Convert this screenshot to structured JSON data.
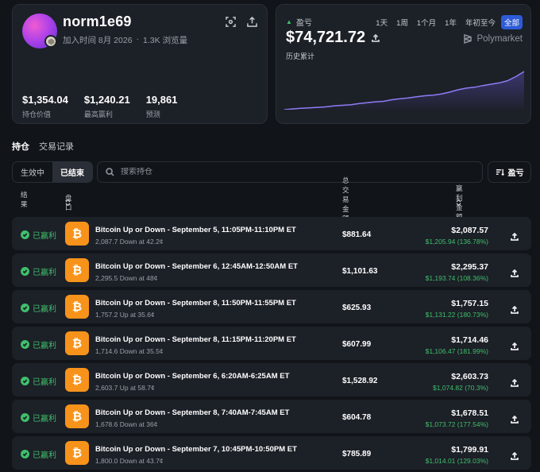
{
  "profile": {
    "username": "norm1e69",
    "joined": "加入时间 8月 2026",
    "separator": "·",
    "views": "1.3K 浏览量",
    "stats": [
      {
        "value": "$1,354.04",
        "label": "持仓价值"
      },
      {
        "value": "$1,240.21",
        "label": "最高赢利"
      },
      {
        "value": "19,861",
        "label": "预测"
      }
    ]
  },
  "pnl": {
    "label": "盈亏",
    "value": "$74,721.72",
    "sub": "历史累计",
    "brand": "Polymarket",
    "periods": [
      "1天",
      "1周",
      "1个月",
      "1年",
      "年初至今",
      "全部"
    ],
    "active_period": "全部",
    "colors": {
      "line": "#8e7cf5",
      "fill": "#4a3f8f"
    }
  },
  "chart_data": {
    "type": "area",
    "x": [
      0,
      1,
      2,
      3,
      4,
      5,
      6,
      7,
      8,
      9,
      10,
      11,
      12,
      13,
      14,
      15,
      16,
      17,
      18,
      19,
      20,
      21,
      22,
      23,
      24,
      25,
      26,
      27,
      28,
      29
    ],
    "values": [
      0,
      0.3,
      0.6,
      0.8,
      1.0,
      1.2,
      1.6,
      1.9,
      2.1,
      2.6,
      3.0,
      3.4,
      3.6,
      4.3,
      4.7,
      5.1,
      5.6,
      6.0,
      6.3,
      6.8,
      7.6,
      8.6,
      9.3,
      9.7,
      10.4,
      11.0,
      11.6,
      12.5,
      14.3,
      16.5
    ],
    "title": "",
    "xlabel": "",
    "ylabel": "",
    "grid": false
  },
  "tabs": [
    "持仓",
    "交易记录"
  ],
  "active_tab": "持仓",
  "segments": [
    "生效中",
    "已结束"
  ],
  "active_segment": "已结束",
  "search": {
    "placeholder": "搜索持仓"
  },
  "sort_label": "盈亏",
  "table": {
    "headers": {
      "result": "结果",
      "market": "盘口",
      "total": "总交易金额",
      "win": "赢利金额"
    },
    "rows": [
      {
        "status": "已赢利",
        "title": "Bitcoin Up or Down - September 5, 11:05PM-11:10PM ET",
        "sub": "2,087.7 Down at 42.2¢",
        "total": "$881.64",
        "win": "$2,087.57",
        "gain": "$1,205.94 (136.78%)"
      },
      {
        "status": "已赢利",
        "title": "Bitcoin Up or Down - September 6, 12:45AM-12:50AM ET",
        "sub": "2,295.5 Down at 48¢",
        "total": "$1,101.63",
        "win": "$2,295.37",
        "gain": "$1,193.74 (108.36%)"
      },
      {
        "status": "已赢利",
        "title": "Bitcoin Up or Down - September 8, 11:50PM-11:55PM ET",
        "sub": "1,757.2 Up at 35.6¢",
        "total": "$625.93",
        "win": "$1,757.15",
        "gain": "$1,131.22 (180.73%)"
      },
      {
        "status": "已赢利",
        "title": "Bitcoin Up or Down - September 8, 11:15PM-11:20PM ET",
        "sub": "1,714.6 Down at 35.5¢",
        "total": "$607.99",
        "win": "$1,714.46",
        "gain": "$1,106.47 (181.99%)"
      },
      {
        "status": "已赢利",
        "title": "Bitcoin Up or Down - September 6, 6:20AM-6:25AM ET",
        "sub": "2,603.7 Up at 58.7¢",
        "total": "$1,528.92",
        "win": "$2,603.73",
        "gain": "$1,074.82 (70.3%)"
      },
      {
        "status": "已赢利",
        "title": "Bitcoin Up or Down - September 8, 7:40AM-7:45AM ET",
        "sub": "1,678.6 Down at 36¢",
        "total": "$604.78",
        "win": "$1,678.51",
        "gain": "$1,073.72 (177.54%)"
      },
      {
        "status": "已赢利",
        "title": "Bitcoin Up or Down - September 7, 10:45PM-10:50PM ET",
        "sub": "1,800.0 Down at 43.7¢",
        "total": "$785.89",
        "win": "$1,799.91",
        "gain": "$1,014.01 (129.03%)"
      }
    ]
  }
}
